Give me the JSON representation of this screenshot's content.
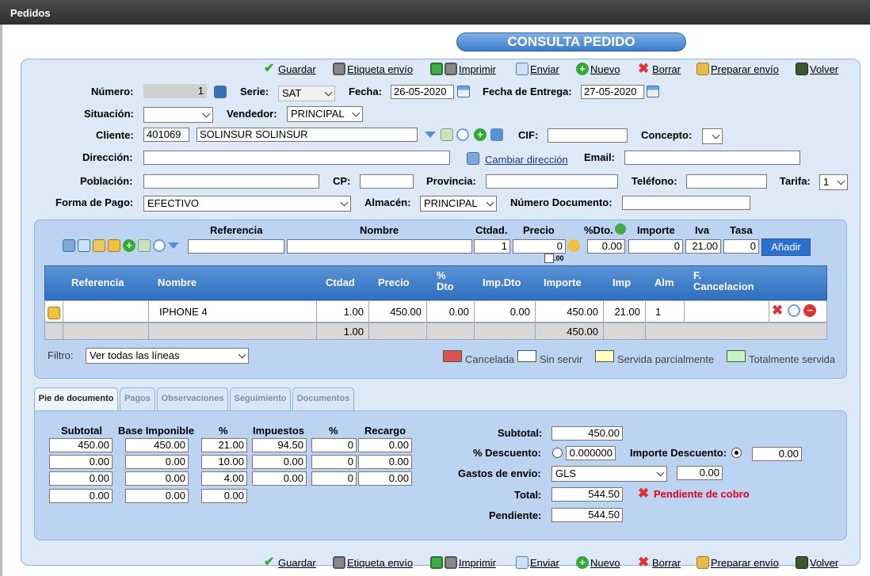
{
  "window": {
    "title": "Pedidos"
  },
  "header": {
    "title": "CONSULTA PEDIDO"
  },
  "toolbar": {
    "guardar": "Guardar",
    "etiqueta": "Etiqueta envío",
    "imprimir": "Imprimir",
    "enviar": "Enviar",
    "nuevo": "Nuevo",
    "borrar": "Borrar",
    "preparar": "Preparar envío",
    "volver": "Volver"
  },
  "form": {
    "numero_label": "Número:",
    "numero": "1",
    "serie_label": "Serie:",
    "serie": "SAT",
    "fecha_label": "Fecha:",
    "fecha": "26-05-2020",
    "entrega_label": "Fecha de Entrega:",
    "entrega": "27-05-2020",
    "situacion_label": "Situación:",
    "situacion": "",
    "vendedor_label": "Vendedor:",
    "vendedor": "PRINCIPAL",
    "cliente_label": "Cliente:",
    "cliente_code": "401069",
    "cliente_name": "SOLINSUR SOLINSUR",
    "cif_label": "CIF:",
    "cif": "",
    "concepto_label": "Concepto:",
    "concepto": "",
    "direccion_label": "Dirección:",
    "direccion": "",
    "cambiar_direccion": "Cambiar dirección",
    "email_label": "Email:",
    "email": "",
    "poblacion_label": "Población:",
    "poblacion": "",
    "cp_label": "CP:",
    "cp": "",
    "provincia_label": "Provincia:",
    "provincia": "",
    "telefono_label": "Teléfono:",
    "telefono": "",
    "tarifa_label": "Tarifa:",
    "tarifa": "1",
    "forma_pago_label": "Forma de Pago:",
    "forma_pago": "EFECTIVO",
    "almacen_label": "Almacén:",
    "almacen": "PRINCIPAL",
    "num_doc_label": "Número Documento:",
    "num_doc": ""
  },
  "entry": {
    "h_referencia": "Referencia",
    "h_nombre": "Nombre",
    "h_ctdad": "Ctdad.",
    "h_precio": "Precio",
    "h_dto": "%Dto.",
    "h_importe": "Importe",
    "h_iva": "Iva",
    "h_tasa": "Tasa",
    "referencia": "",
    "nombre": "",
    "ctdad": "1",
    "precio": "0",
    "precio_dec": ".00",
    "dto": "0.00",
    "importe": "0",
    "iva": "21.00",
    "tasa": "0",
    "add_button": "Añadir"
  },
  "lines": {
    "headers": {
      "referencia": "Referencia",
      "nombre": "Nombre",
      "ctdad": "Ctdad",
      "precio": "Precio",
      "dto": "%\nDto",
      "impdto": "Imp.Dto",
      "importe": "Importe",
      "imp": "Imp",
      "alm": "Alm",
      "fcanc": "F.\nCancelacion"
    },
    "rows": [
      {
        "referencia": "",
        "nombre": "IPHONE 4",
        "ctdad": "1.00",
        "precio": "450.00",
        "dto": "0.00",
        "impdto": "0.00",
        "importe": "450.00",
        "imp": "21.00",
        "alm": "1",
        "fcanc": ""
      }
    ],
    "totals": {
      "ctdad": "1.00",
      "importe": "450.00"
    }
  },
  "filter": {
    "label": "Filtro:",
    "value": "Ver todas las líneas"
  },
  "legend": {
    "cancelada": "Cancelada",
    "sin_servir": "Sin servir",
    "parcial": "Servida parcialmente",
    "total": "Totalmente servida",
    "colors": {
      "cancelada": "#d9534f",
      "sin_servir": "#ffffff",
      "parcial": "#ffffc0",
      "total": "#c8f5c8"
    }
  },
  "tabs": [
    "Pie de documento",
    "Pagos",
    "Observaciones",
    "Seguimiento",
    "Documentos"
  ],
  "taxes": {
    "headers": {
      "subtotal": "Subtotal",
      "base": "Base Imponible",
      "pct": "%",
      "impuestos": "Impuestos",
      "pct2": "%",
      "recargo": "Recargo"
    },
    "rows": [
      {
        "subtotal": "450.00",
        "base": "450.00",
        "pct": "21.00",
        "impuestos": "94.50",
        "pct2": "0",
        "recargo": "0.00"
      },
      {
        "subtotal": "0.00",
        "base": "0.00",
        "pct": "10.00",
        "impuestos": "0.00",
        "pct2": "0",
        "recargo": "0.00"
      },
      {
        "subtotal": "0.00",
        "base": "0.00",
        "pct": "4.00",
        "impuestos": "0.00",
        "pct2": "0",
        "recargo": "0.00"
      },
      {
        "subtotal": "0.00",
        "base": "0.00",
        "pct": "0.00"
      }
    ]
  },
  "summary": {
    "subtotal_label": "Subtotal:",
    "subtotal": "450.00",
    "descuento_label": "% Descuento:",
    "descuento": "0.000000",
    "imp_descuento_label": "Importe Descuento:",
    "imp_descuento": "0.00",
    "gastos_label": "Gastos de envío:",
    "gastos_carrier": "GLS",
    "gastos": "0.00",
    "total_label": "Total:",
    "total": "544.50",
    "status": "Pendiente de cobro",
    "status_color": "#e0001b",
    "pendiente_label": "Pendiente:",
    "pendiente": "544.50"
  }
}
